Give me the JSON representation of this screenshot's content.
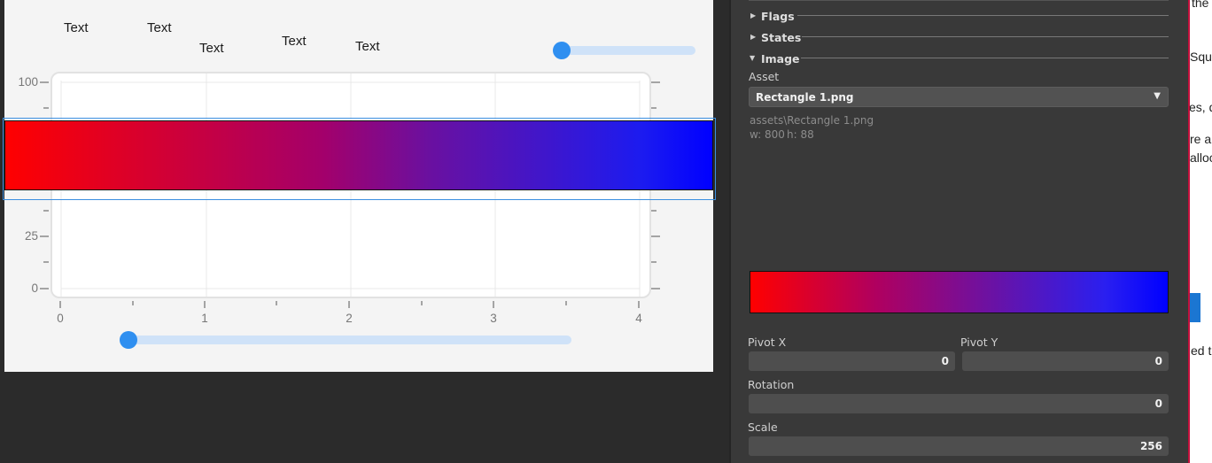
{
  "canvas": {
    "texts": [
      "Text",
      "Text",
      "Text",
      "Text",
      "Text"
    ],
    "top_slider_value": 0,
    "bottom_slider_value": 0,
    "chart_data": {
      "type": "line",
      "x_ticks": [
        "0",
        "1",
        "2",
        "3",
        "4"
      ],
      "y_ticks": [
        "0",
        "25",
        "100"
      ],
      "xlim": [
        0,
        4
      ],
      "ylim": [
        0,
        100
      ],
      "grid": true
    },
    "image_colors": {
      "start": "#ff0000",
      "end": "#0000ff"
    }
  },
  "inspector": {
    "sections": {
      "flags": "Flags",
      "states": "States",
      "image": "Image"
    },
    "asset_label": "Asset",
    "asset_value": "Rectangle 1.png",
    "asset_path": "assets\\Rectangle 1.png",
    "asset_width": "w: 800",
    "asset_height": "h: 88",
    "pivot_x_label": "Pivot X",
    "pivot_x_value": "0",
    "pivot_y_label": "Pivot Y",
    "pivot_y_value": "0",
    "rotation_label": "Rotation",
    "rotation_value": "0",
    "scale_label": "Scale",
    "scale_value": "256"
  },
  "peek": {
    "lines": [
      "the",
      "Squ",
      "es, d",
      "re a",
      "alloc",
      "ed th"
    ]
  },
  "icons": {
    "collapsed": "triangle-right",
    "expanded": "triangle-down",
    "dropdown": "caret-down"
  }
}
